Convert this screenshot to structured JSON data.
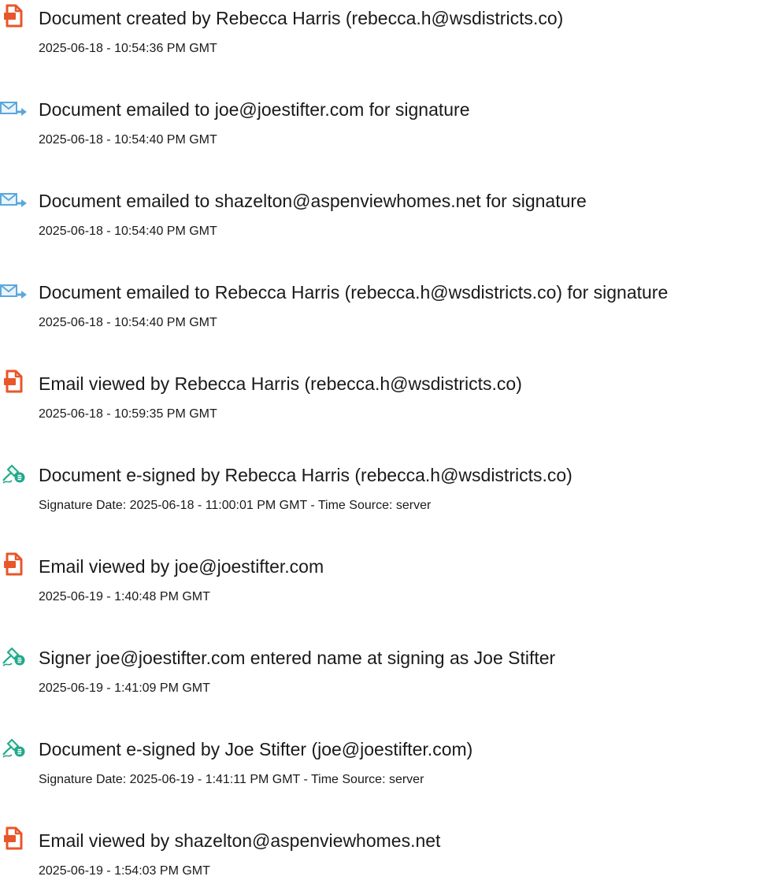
{
  "colors": {
    "doc_icon": "#e8562a",
    "email_icon": "#5aa8db",
    "esign_icon": "#22a88a",
    "text": "#1a1a1a"
  },
  "events": [
    {
      "icon": "document-icon",
      "title": "Document created by Rebecca Harris (rebecca.h@wsdistricts.co)",
      "time": "2025-06-18 - 10:54:36 PM GMT"
    },
    {
      "icon": "email-icon",
      "title": "Document emailed to joe@joestifter.com for signature",
      "time": "2025-06-18 - 10:54:40 PM GMT"
    },
    {
      "icon": "email-icon",
      "title": "Document emailed to shazelton@aspenviewhomes.net for signature",
      "time": "2025-06-18 - 10:54:40 PM GMT"
    },
    {
      "icon": "email-icon",
      "title": "Document emailed to Rebecca Harris (rebecca.h@wsdistricts.co) for signature",
      "time": "2025-06-18 - 10:54:40 PM GMT"
    },
    {
      "icon": "document-icon",
      "title": "Email viewed by Rebecca Harris (rebecca.h@wsdistricts.co)",
      "time": "2025-06-18 - 10:59:35 PM GMT"
    },
    {
      "icon": "esign-icon",
      "title": "Document e-signed by Rebecca Harris (rebecca.h@wsdistricts.co)",
      "time": "Signature Date: 2025-06-18 - 11:00:01 PM GMT - Time Source: server"
    },
    {
      "icon": "document-icon",
      "title": "Email viewed by joe@joestifter.com",
      "time": "2025-06-19 - 1:40:48 PM GMT"
    },
    {
      "icon": "esign-icon",
      "title": "Signer joe@joestifter.com entered name at signing as Joe Stifter",
      "time": "2025-06-19 - 1:41:09 PM GMT"
    },
    {
      "icon": "esign-icon",
      "title": "Document e-signed by Joe Stifter (joe@joestifter.com)",
      "time": "Signature Date: 2025-06-19 - 1:41:11 PM GMT - Time Source: server"
    },
    {
      "icon": "document-icon",
      "title": "Email viewed by shazelton@aspenviewhomes.net",
      "time": "2025-06-19 - 1:54:03 PM GMT"
    }
  ]
}
